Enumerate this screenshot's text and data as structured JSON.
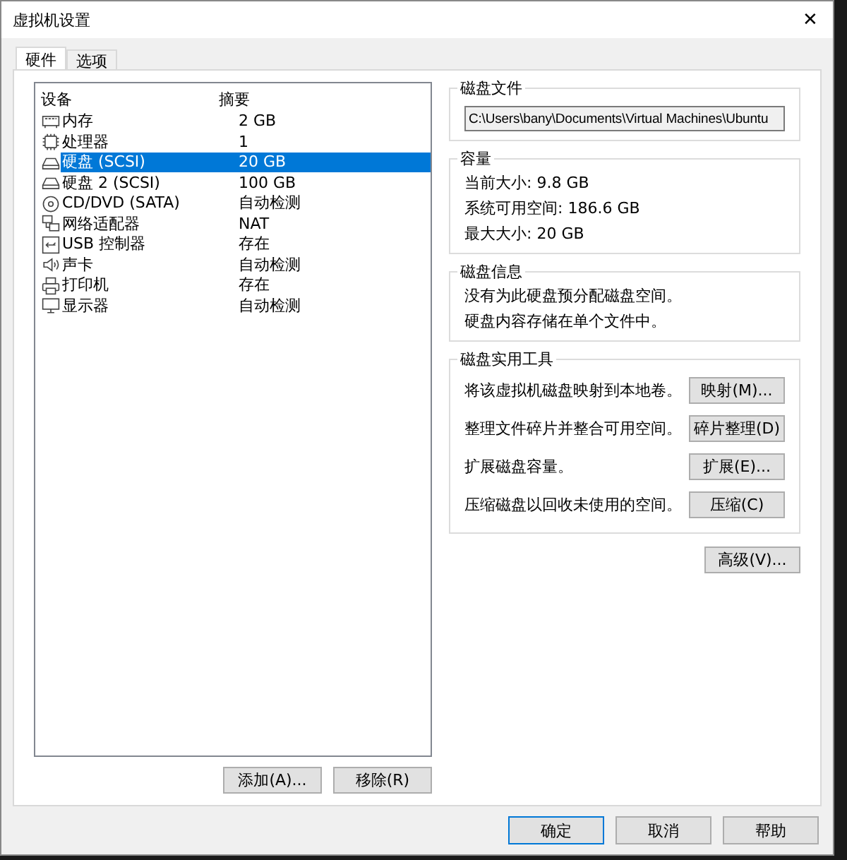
{
  "window": {
    "title": "虚拟机设置",
    "close": "✕"
  },
  "tabs": [
    {
      "label": "硬件",
      "selected": true
    },
    {
      "label": "选项",
      "selected": false
    }
  ],
  "devices": {
    "columns": [
      "设备",
      "摘要"
    ],
    "rows": [
      {
        "kind": "memory",
        "name": "内存",
        "summary": "2 GB",
        "selected": false
      },
      {
        "kind": "cpu",
        "name": "处理器",
        "summary": "1",
        "selected": false
      },
      {
        "kind": "disk",
        "name": "硬盘 (SCSI)",
        "summary": "20 GB",
        "selected": true
      },
      {
        "kind": "disk",
        "name": "硬盘 2 (SCSI)",
        "summary": "100 GB",
        "selected": false
      },
      {
        "kind": "cdrom",
        "name": "CD/DVD (SATA)",
        "summary": "自动检测",
        "selected": false
      },
      {
        "kind": "network",
        "name": "网络适配器",
        "summary": "NAT",
        "selected": false
      },
      {
        "kind": "usb",
        "name": "USB 控制器",
        "summary": "存在",
        "selected": false
      },
      {
        "kind": "sound",
        "name": "声卡",
        "summary": "自动检测",
        "selected": false
      },
      {
        "kind": "printer",
        "name": "打印机",
        "summary": "存在",
        "selected": false
      },
      {
        "kind": "display",
        "name": "显示器",
        "summary": "自动检测",
        "selected": false
      }
    ],
    "buttons": [
      "添加(A)...",
      "移除(R)"
    ]
  },
  "disk_file": {
    "title": "磁盘文件",
    "value": "C:\\Users\\bany\\Documents\\Virtual Machines\\Ubuntu"
  },
  "capacity": {
    "title": "容量",
    "lines": [
      "当前大小: 9.8 GB",
      "系统可用空间: 186.6 GB",
      "最大大小: 20 GB"
    ]
  },
  "disk_info": {
    "title": "磁盘信息",
    "lines": [
      "没有为此硬盘预分配磁盘空间。",
      "硬盘内容存储在单个文件中。"
    ]
  },
  "utilities": {
    "title": "磁盘实用工具",
    "items": [
      {
        "text": "将该虚拟机磁盘映射到本地卷。",
        "button": "映射(M)..."
      },
      {
        "text": "整理文件碎片并整合可用空间。",
        "button": "碎片整理(D)"
      },
      {
        "text": "扩展磁盘容量。",
        "button": "扩展(E)..."
      },
      {
        "text": "压缩磁盘以回收未使用的空间。",
        "button": "压缩(C)"
      }
    ]
  },
  "advanced_button": "高级(V)...",
  "footer_buttons": [
    {
      "label": "确定",
      "default": true
    },
    {
      "label": "取消",
      "default": false
    },
    {
      "label": "帮助",
      "default": false
    }
  ]
}
